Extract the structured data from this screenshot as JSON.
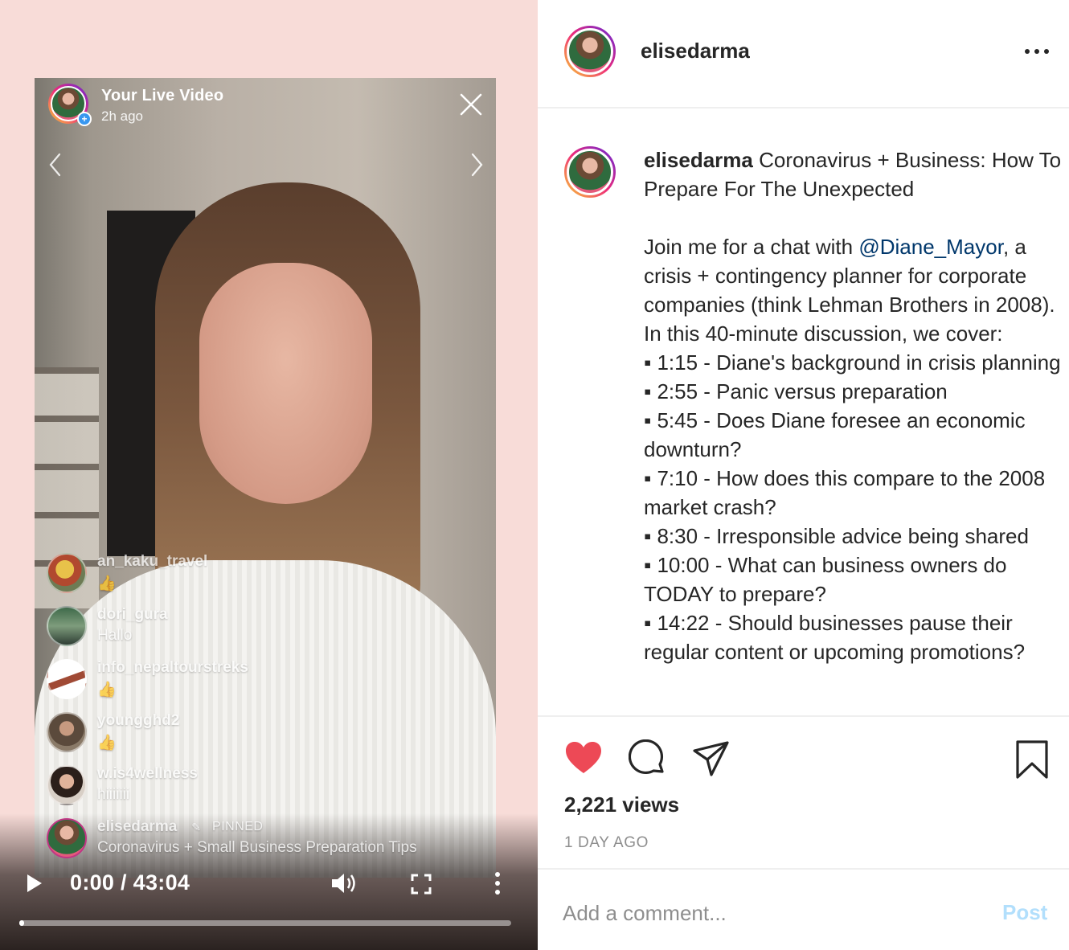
{
  "live": {
    "title": "Your Live Video",
    "subtitle": "2h ago",
    "comments": [
      {
        "user": "an_kaku_travel",
        "message": "👍"
      },
      {
        "user": "dori_gura",
        "message": "Hallo"
      },
      {
        "user": "info_nepaltourstreks",
        "message": "👍"
      },
      {
        "user": "youngghd2",
        "message": "👍"
      },
      {
        "user": "w.is4wellness",
        "message": "hiiiiiii"
      }
    ],
    "pinned": {
      "user": "elisedarma",
      "pin_icon": "pin-icon",
      "label": "PINNED",
      "message": "Coronavirus + Small Business Preparation Tips"
    },
    "player": {
      "time": "0:00 / 43:04",
      "progress": 0.01
    }
  },
  "post": {
    "username": "elisedarma",
    "caption_user": "elisedarma",
    "caption_title": " Coronavirus + Business: How To Prepare For The Unexpected\n\nJoin me for a chat with ",
    "mention": "@Diane_Mayor",
    "caption_body": ", a crisis + contingency planner for corporate companies (think Lehman Brothers in 2008). In this 40-minute discussion, we cover:\n▪ 1:15 - Diane's background in crisis planning\n▪ 2:55 - Panic versus preparation\n▪ 5:45 - Does Diane foresee an economic downturn?\n▪ 7:10 - How does this compare to the 2008 market crash?\n▪ 8:30 - Irresponsible advice being shared\n▪ 10:00 - What can business owners do TODAY to prepare?\n▪ 14:22 - Should businesses pause their regular content or upcoming promotions?",
    "views": "2,221 views",
    "posted": "1 DAY AGO",
    "comment_placeholder": "Add a comment...",
    "post_label": "Post"
  },
  "colors": {
    "background_left": "#f8dcd8",
    "like": "#ed4956",
    "mention": "#00376b",
    "post_disabled": "#b2dffc",
    "meta": "#8e8e8e"
  },
  "icons": [
    "close-icon",
    "chevron-left-icon",
    "chevron-right-icon",
    "play-icon",
    "volume-icon",
    "fullscreen-icon",
    "more-vertical-icon",
    "more-horizontal-icon",
    "heart-icon",
    "comment-icon",
    "share-icon",
    "bookmark-icon"
  ]
}
